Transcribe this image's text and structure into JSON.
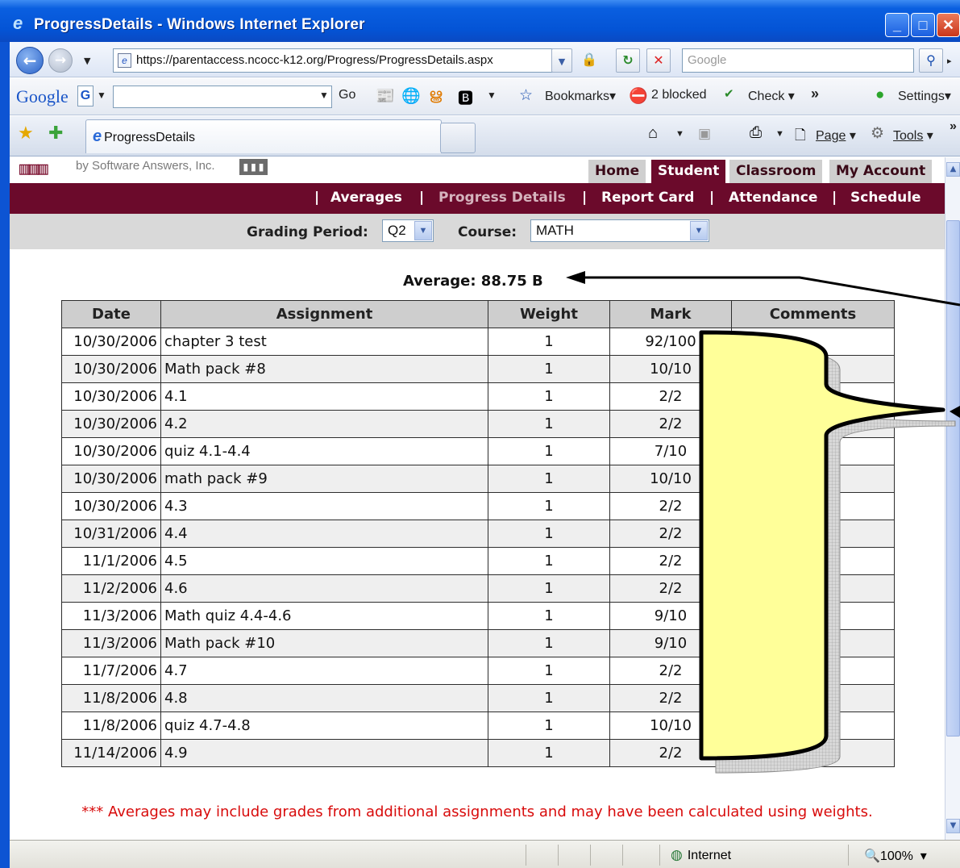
{
  "window": {
    "title": "ProgressDetails - Windows Internet Explorer"
  },
  "browser": {
    "url": "https://parentaccess.ncocc-k12.org/Progress/ProgressDetails.aspx",
    "search_placeholder": "Google",
    "google_bar": {
      "logo": "Google",
      "box_letter": "G",
      "go_label": "Go",
      "bookmarks_label": "Bookmarks",
      "blocked_label": "2 blocked",
      "check_label": "Check",
      "settings_label": "Settings"
    },
    "tab_title": "ProgressDetails",
    "command_bar": {
      "page_label": "Page",
      "tools_label": "Tools"
    }
  },
  "site": {
    "byline": "by Software Answers, Inc.",
    "top_tabs": [
      "Home",
      "Student",
      "Classroom",
      "My Account"
    ],
    "active_top_tab": "Student",
    "subnav": [
      "Averages",
      "Progress Details",
      "Report Card",
      "Attendance",
      "Schedule"
    ],
    "current_subnav": "Progress Details"
  },
  "filters": {
    "grading_period_label": "Grading Period:",
    "grading_period_value": "Q2",
    "course_label": "Course:",
    "course_value": "MATH"
  },
  "average_text": "Average: 88.75 B",
  "table": {
    "columns": [
      "Date",
      "Assignment",
      "Weight",
      "Mark",
      "Comments"
    ],
    "rows": [
      [
        "10/30/2006",
        "chapter 3 test",
        "1",
        "92/100",
        ""
      ],
      [
        "10/30/2006",
        "Math pack #8",
        "1",
        "10/10",
        ""
      ],
      [
        "10/30/2006",
        "4.1",
        "1",
        "2/2",
        ""
      ],
      [
        "10/30/2006",
        "4.2",
        "1",
        "2/2",
        ""
      ],
      [
        "10/30/2006",
        "quiz 4.1-4.4",
        "1",
        "7/10",
        ""
      ],
      [
        "10/30/2006",
        "math pack #9",
        "1",
        "10/10",
        ""
      ],
      [
        "10/30/2006",
        "4.3",
        "1",
        "2/2",
        ""
      ],
      [
        "10/31/2006",
        "4.4",
        "1",
        "2/2",
        ""
      ],
      [
        "11/1/2006",
        "4.5",
        "1",
        "2/2",
        ""
      ],
      [
        "11/2/2006",
        "4.6",
        "1",
        "2/2",
        ""
      ],
      [
        "11/3/2006",
        "Math quiz 4.4-4.6",
        "1",
        "9/10",
        ""
      ],
      [
        "11/3/2006",
        "Math pack #10",
        "1",
        "9/10",
        ""
      ],
      [
        "11/7/2006",
        "4.7",
        "1",
        "2/2",
        ""
      ],
      [
        "11/8/2006",
        "4.8",
        "1",
        "2/2",
        ""
      ],
      [
        "11/8/2006",
        "quiz 4.7-4.8",
        "1",
        "10/10",
        ""
      ],
      [
        "11/14/2006",
        "4.9",
        "1",
        "2/2",
        ""
      ]
    ]
  },
  "note": "*** Averages may include grades from additional assignments and may have been calculated using weights.",
  "status": {
    "zone": "Internet",
    "zoom": "100%"
  },
  "colors": {
    "maroon": "#6b0a2b",
    "highlight_yellow": "#ffff99",
    "note_red": "#d80b0b"
  }
}
